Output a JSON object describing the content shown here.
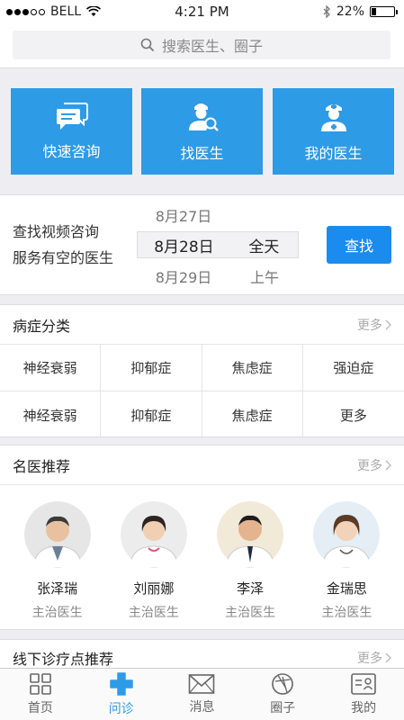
{
  "status": {
    "carrier": "BELL",
    "time": "4:21 PM",
    "battery": "22%",
    "battery_level": 0.22
  },
  "search": {
    "placeholder": "搜索医生、圈子",
    "icon": "search-icon"
  },
  "tiles": [
    {
      "label": "快速咨询",
      "icon": "chat-bubbles-icon"
    },
    {
      "label": "找医生",
      "icon": "doctor-search-icon"
    },
    {
      "label": "我的医生",
      "icon": "nurse-icon"
    }
  ],
  "finder": {
    "line1": "查找视频咨询",
    "line2": "服务有空的医生",
    "dates": [
      {
        "date": "8月27日",
        "period": ""
      },
      {
        "date": "8月28日",
        "period": "全天"
      },
      {
        "date": "8月29日",
        "period": "上午"
      }
    ],
    "button": "查找"
  },
  "diseases": {
    "title": "病症分类",
    "more": "更多",
    "items": [
      "神经衰弱",
      "抑郁症",
      "焦虑症",
      "强迫症",
      "神经衰弱",
      "抑郁症",
      "焦虑症",
      "更多"
    ]
  },
  "doctors": {
    "title": "名医推荐",
    "more": "更多",
    "items": [
      {
        "name": "张泽瑞",
        "title": "主治医生"
      },
      {
        "name": "刘丽娜",
        "title": "主治医生"
      },
      {
        "name": "李泽",
        "title": "主治医生"
      },
      {
        "name": "金瑞思",
        "title": "主治医生"
      }
    ]
  },
  "clinics": {
    "title": "线下诊疗点推荐",
    "more": "更多"
  },
  "tabbar": [
    {
      "label": "首页",
      "icon": "grid-icon",
      "active": false
    },
    {
      "label": "问诊",
      "icon": "medical-cross-icon",
      "active": true
    },
    {
      "label": "消息",
      "icon": "envelope-icon",
      "active": false
    },
    {
      "label": "圈子",
      "icon": "aperture-icon",
      "active": false
    },
    {
      "label": "我的",
      "icon": "profile-card-icon",
      "active": false
    }
  ],
  "colors": {
    "accent": "#2e9be6",
    "button": "#1a8cf0"
  }
}
